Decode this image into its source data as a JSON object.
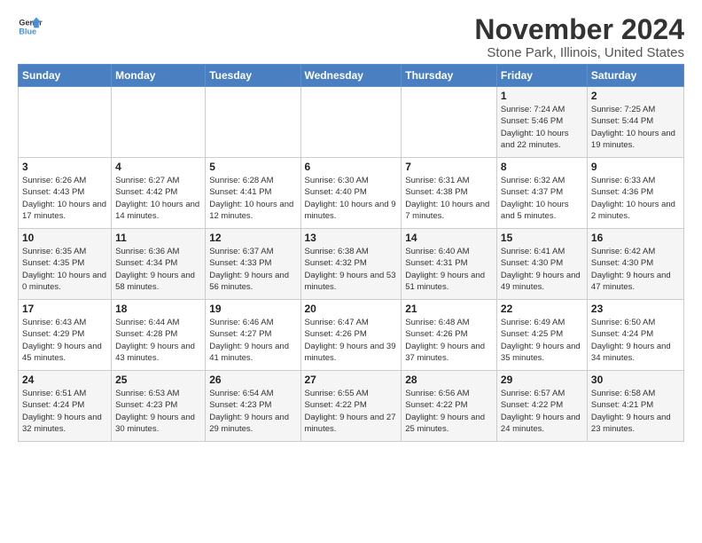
{
  "logo": {
    "line1": "General",
    "line2": "Blue"
  },
  "title": "November 2024",
  "subtitle": "Stone Park, Illinois, United States",
  "days_of_week": [
    "Sunday",
    "Monday",
    "Tuesday",
    "Wednesday",
    "Thursday",
    "Friday",
    "Saturday"
  ],
  "weeks": [
    [
      {
        "day": "",
        "info": ""
      },
      {
        "day": "",
        "info": ""
      },
      {
        "day": "",
        "info": ""
      },
      {
        "day": "",
        "info": ""
      },
      {
        "day": "",
        "info": ""
      },
      {
        "day": "1",
        "info": "Sunrise: 7:24 AM\nSunset: 5:46 PM\nDaylight: 10 hours and 22 minutes."
      },
      {
        "day": "2",
        "info": "Sunrise: 7:25 AM\nSunset: 5:44 PM\nDaylight: 10 hours and 19 minutes."
      }
    ],
    [
      {
        "day": "3",
        "info": "Sunrise: 6:26 AM\nSunset: 4:43 PM\nDaylight: 10 hours and 17 minutes."
      },
      {
        "day": "4",
        "info": "Sunrise: 6:27 AM\nSunset: 4:42 PM\nDaylight: 10 hours and 14 minutes."
      },
      {
        "day": "5",
        "info": "Sunrise: 6:28 AM\nSunset: 4:41 PM\nDaylight: 10 hours and 12 minutes."
      },
      {
        "day": "6",
        "info": "Sunrise: 6:30 AM\nSunset: 4:40 PM\nDaylight: 10 hours and 9 minutes."
      },
      {
        "day": "7",
        "info": "Sunrise: 6:31 AM\nSunset: 4:38 PM\nDaylight: 10 hours and 7 minutes."
      },
      {
        "day": "8",
        "info": "Sunrise: 6:32 AM\nSunset: 4:37 PM\nDaylight: 10 hours and 5 minutes."
      },
      {
        "day": "9",
        "info": "Sunrise: 6:33 AM\nSunset: 4:36 PM\nDaylight: 10 hours and 2 minutes."
      }
    ],
    [
      {
        "day": "10",
        "info": "Sunrise: 6:35 AM\nSunset: 4:35 PM\nDaylight: 10 hours and 0 minutes."
      },
      {
        "day": "11",
        "info": "Sunrise: 6:36 AM\nSunset: 4:34 PM\nDaylight: 9 hours and 58 minutes."
      },
      {
        "day": "12",
        "info": "Sunrise: 6:37 AM\nSunset: 4:33 PM\nDaylight: 9 hours and 56 minutes."
      },
      {
        "day": "13",
        "info": "Sunrise: 6:38 AM\nSunset: 4:32 PM\nDaylight: 9 hours and 53 minutes."
      },
      {
        "day": "14",
        "info": "Sunrise: 6:40 AM\nSunset: 4:31 PM\nDaylight: 9 hours and 51 minutes."
      },
      {
        "day": "15",
        "info": "Sunrise: 6:41 AM\nSunset: 4:30 PM\nDaylight: 9 hours and 49 minutes."
      },
      {
        "day": "16",
        "info": "Sunrise: 6:42 AM\nSunset: 4:30 PM\nDaylight: 9 hours and 47 minutes."
      }
    ],
    [
      {
        "day": "17",
        "info": "Sunrise: 6:43 AM\nSunset: 4:29 PM\nDaylight: 9 hours and 45 minutes."
      },
      {
        "day": "18",
        "info": "Sunrise: 6:44 AM\nSunset: 4:28 PM\nDaylight: 9 hours and 43 minutes."
      },
      {
        "day": "19",
        "info": "Sunrise: 6:46 AM\nSunset: 4:27 PM\nDaylight: 9 hours and 41 minutes."
      },
      {
        "day": "20",
        "info": "Sunrise: 6:47 AM\nSunset: 4:26 PM\nDaylight: 9 hours and 39 minutes."
      },
      {
        "day": "21",
        "info": "Sunrise: 6:48 AM\nSunset: 4:26 PM\nDaylight: 9 hours and 37 minutes."
      },
      {
        "day": "22",
        "info": "Sunrise: 6:49 AM\nSunset: 4:25 PM\nDaylight: 9 hours and 35 minutes."
      },
      {
        "day": "23",
        "info": "Sunrise: 6:50 AM\nSunset: 4:24 PM\nDaylight: 9 hours and 34 minutes."
      }
    ],
    [
      {
        "day": "24",
        "info": "Sunrise: 6:51 AM\nSunset: 4:24 PM\nDaylight: 9 hours and 32 minutes."
      },
      {
        "day": "25",
        "info": "Sunrise: 6:53 AM\nSunset: 4:23 PM\nDaylight: 9 hours and 30 minutes."
      },
      {
        "day": "26",
        "info": "Sunrise: 6:54 AM\nSunset: 4:23 PM\nDaylight: 9 hours and 29 minutes."
      },
      {
        "day": "27",
        "info": "Sunrise: 6:55 AM\nSunset: 4:22 PM\nDaylight: 9 hours and 27 minutes."
      },
      {
        "day": "28",
        "info": "Sunrise: 6:56 AM\nSunset: 4:22 PM\nDaylight: 9 hours and 25 minutes."
      },
      {
        "day": "29",
        "info": "Sunrise: 6:57 AM\nSunset: 4:22 PM\nDaylight: 9 hours and 24 minutes."
      },
      {
        "day": "30",
        "info": "Sunrise: 6:58 AM\nSunset: 4:21 PM\nDaylight: 9 hours and 23 minutes."
      }
    ]
  ]
}
